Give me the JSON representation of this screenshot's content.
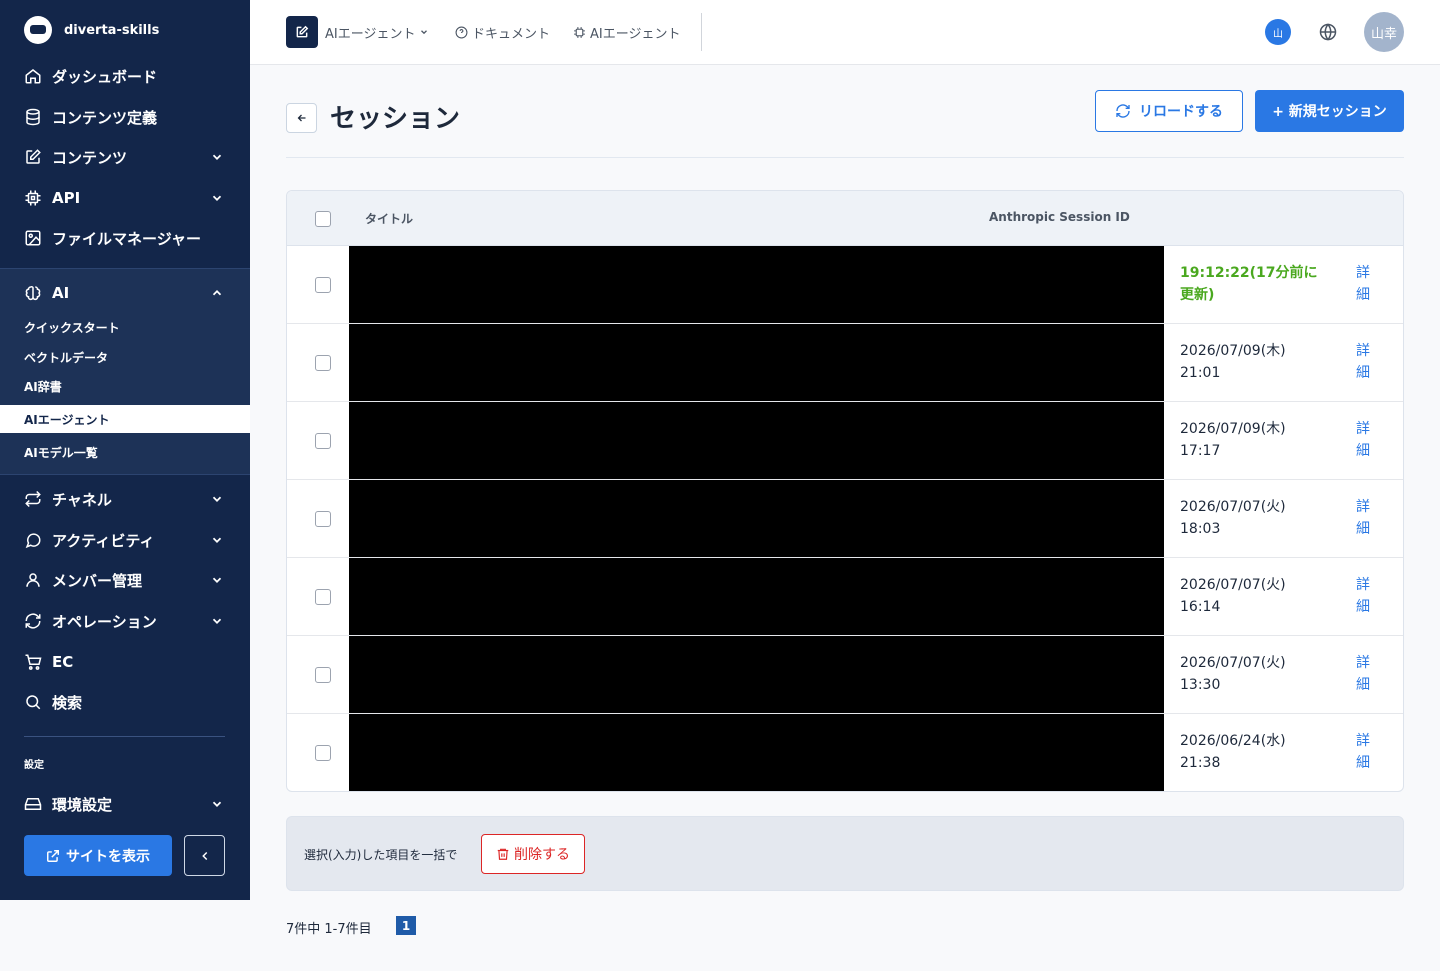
{
  "brand": {
    "name": "diverta-skills"
  },
  "sidebar": {
    "items": [
      {
        "label": "ダッシュボード",
        "icon": "home-icon"
      },
      {
        "label": "コンテンツ定義",
        "icon": "database-icon"
      },
      {
        "label": "コンテンツ",
        "icon": "edit-icon"
      },
      {
        "label": "API",
        "icon": "chip-icon"
      },
      {
        "label": "ファイルマネージャー",
        "icon": "image-icon"
      }
    ],
    "ai": {
      "label": "AI",
      "icon": "brain-icon",
      "subitems": [
        "クイックスタート",
        "ベクトルデータ",
        "AI辞書",
        "AIエージェント",
        "AIモデル一覧"
      ]
    },
    "items2": [
      {
        "label": "チャネル",
        "icon": "swap-icon"
      },
      {
        "label": "アクティビティ",
        "icon": "chat-icon"
      },
      {
        "label": "メンバー管理",
        "icon": "user-icon"
      },
      {
        "label": "オペレーション",
        "icon": "refresh-icon"
      },
      {
        "label": "EC",
        "icon": "cart-icon"
      },
      {
        "label": "検索",
        "icon": "search-icon"
      }
    ],
    "section_label": "設定",
    "settings_item": {
      "label": "環境設定",
      "icon": "drive-icon"
    },
    "site_button": "サイトを表示"
  },
  "topbar": {
    "agent_dropdown": "AIエージェント",
    "docs_link": "ドキュメント",
    "agent_link": "AIエージェント",
    "small_avatar": "山",
    "avatar": "山幸"
  },
  "header": {
    "title": "セッション",
    "reload_label": "リロードする",
    "new_label": "+ 新規セッション"
  },
  "table": {
    "columns": [
      "タイトル",
      "Anthropic Session ID"
    ],
    "detail_label": "詳細",
    "rows": [
      {
        "date": "19:12:22(17分前に更新)",
        "recent": true
      },
      {
        "date": "2026/07/09(木) 21:01",
        "recent": false
      },
      {
        "date": "2026/07/09(木) 17:17",
        "recent": false
      },
      {
        "date": "2026/07/07(火) 18:03",
        "recent": false
      },
      {
        "date": "2026/07/07(火) 16:14",
        "recent": false
      },
      {
        "date": "2026/07/07(火) 13:30",
        "recent": false
      },
      {
        "date": "2026/06/24(水) 21:38",
        "recent": false
      }
    ]
  },
  "bulk": {
    "text": "選択(入力)した項目を一括で",
    "delete_label": "削除する"
  },
  "pagination": {
    "summary": "7件中 1-7件目",
    "current": "1"
  },
  "colors": {
    "sidebar_bg": "#13264a",
    "accent": "#2a78e4",
    "recent": "#4aa81f",
    "danger": "#dc2626"
  }
}
